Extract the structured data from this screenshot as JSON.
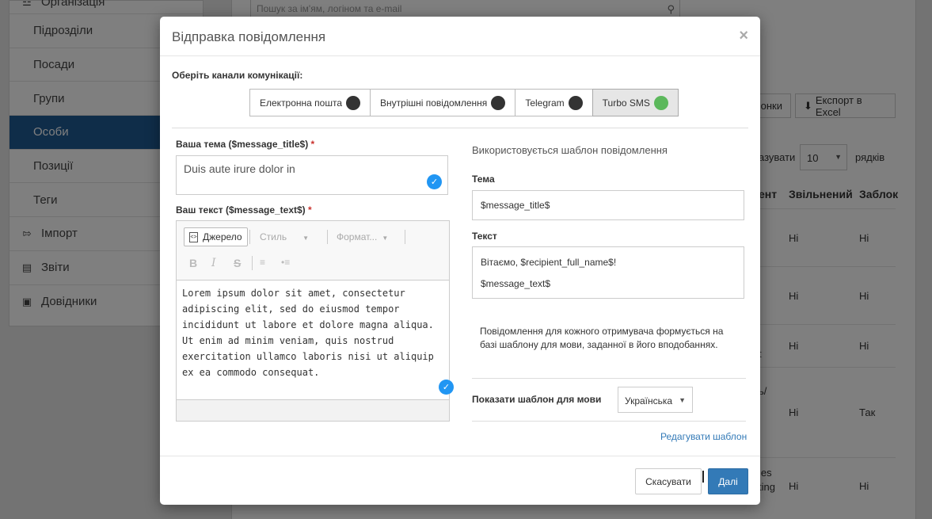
{
  "sidebar": {
    "items": [
      {
        "label": "Організація",
        "icon": "org-chart-icon"
      },
      {
        "label": "Підрозділи"
      },
      {
        "label": "Посади"
      },
      {
        "label": "Групи"
      },
      {
        "label": "Особи",
        "active": true
      },
      {
        "label": "Позиції"
      },
      {
        "label": "Теги"
      },
      {
        "label": "Імпорт",
        "icon": "import-icon"
      },
      {
        "label": "Звіти",
        "icon": "bar-chart-icon"
      },
      {
        "label": "Довідники",
        "icon": "book-icon"
      }
    ]
  },
  "background": {
    "search_placeholder": "Пошук за ім'ям, логіном та e-mail",
    "btn_partial": "онки",
    "btn_export": "Експорт в Excel",
    "show_partial": "азувати",
    "rows_select": "10",
    "rows_label": "рядків",
    "col_partial": "ент",
    "col_fired": "Звільнений",
    "col_blocked": "Заблок",
    "rows": [
      {
        "c1": "",
        "fired": "Ні",
        "blocked": "Ні"
      },
      {
        "c1": "",
        "fired": "Ні",
        "blocked": "Ні"
      },
      {
        "c1": "t",
        "fired": "Ні",
        "blocked": "Ні"
      },
      {
        "c1": "ь/",
        "fired": "Ні",
        "blocked": "Так"
      },
      {
        "c1": "les\nting",
        "fired": "Ні",
        "blocked": "Ні"
      }
    ]
  },
  "modal": {
    "title": "Відправка повідомлення",
    "close_glyph": "×",
    "channels_label": "Оберіть канали комунікації:",
    "channels": [
      {
        "label": "Електронна пошта",
        "on": false
      },
      {
        "label": "Внутрішні повідомлення",
        "on": false
      },
      {
        "label": "Telegram",
        "on": false
      },
      {
        "label": "Turbo SMS",
        "on": true
      }
    ],
    "subject_label": "Ваша тема ($message_title$)",
    "subject_value": "Duis aute irure dolor in",
    "text_label": "Ваш текст ($message_text$)",
    "required_mark": "*",
    "editor": {
      "source_btn": "Джерело",
      "style_combo": "Стиль",
      "format_combo": "Формат...",
      "body": "Lorem ipsum dolor sit amet, consectetur\nadipiscing elit, sed do eiusmod tempor\nincididunt ut labore et dolore magna aliqua.\nUt enim ad minim veniam, quis nostrud\nexercitation ullamco laboris nisi ut aliquip\nex ea commodo consequat."
    },
    "template_note": "Використовується шаблон повідомлення",
    "tpl_subject_label": "Тема",
    "tpl_subject_value": "$message_title$",
    "tpl_text_label": "Текст",
    "tpl_text_line1": "Вітаємо, $recipient_full_name$!",
    "tpl_text_line2": "$message_text$",
    "info": "Повідомлення для кожного отримувача формується на базі шаблону для мови, заданної в його вподобаннях.",
    "lang_label": "Показати шаблон для мови",
    "lang_value": "Українська",
    "edit_link": "Редагувати шаблон",
    "cancel_btn": "Скасувати",
    "next_btn": "Далі"
  },
  "colors": {
    "active_sidebar": "#1f5a93",
    "primary_button": "#337ab7",
    "check_badge": "#2196f3",
    "channel_on": "#5cb85c",
    "channel_off": "#333333"
  }
}
